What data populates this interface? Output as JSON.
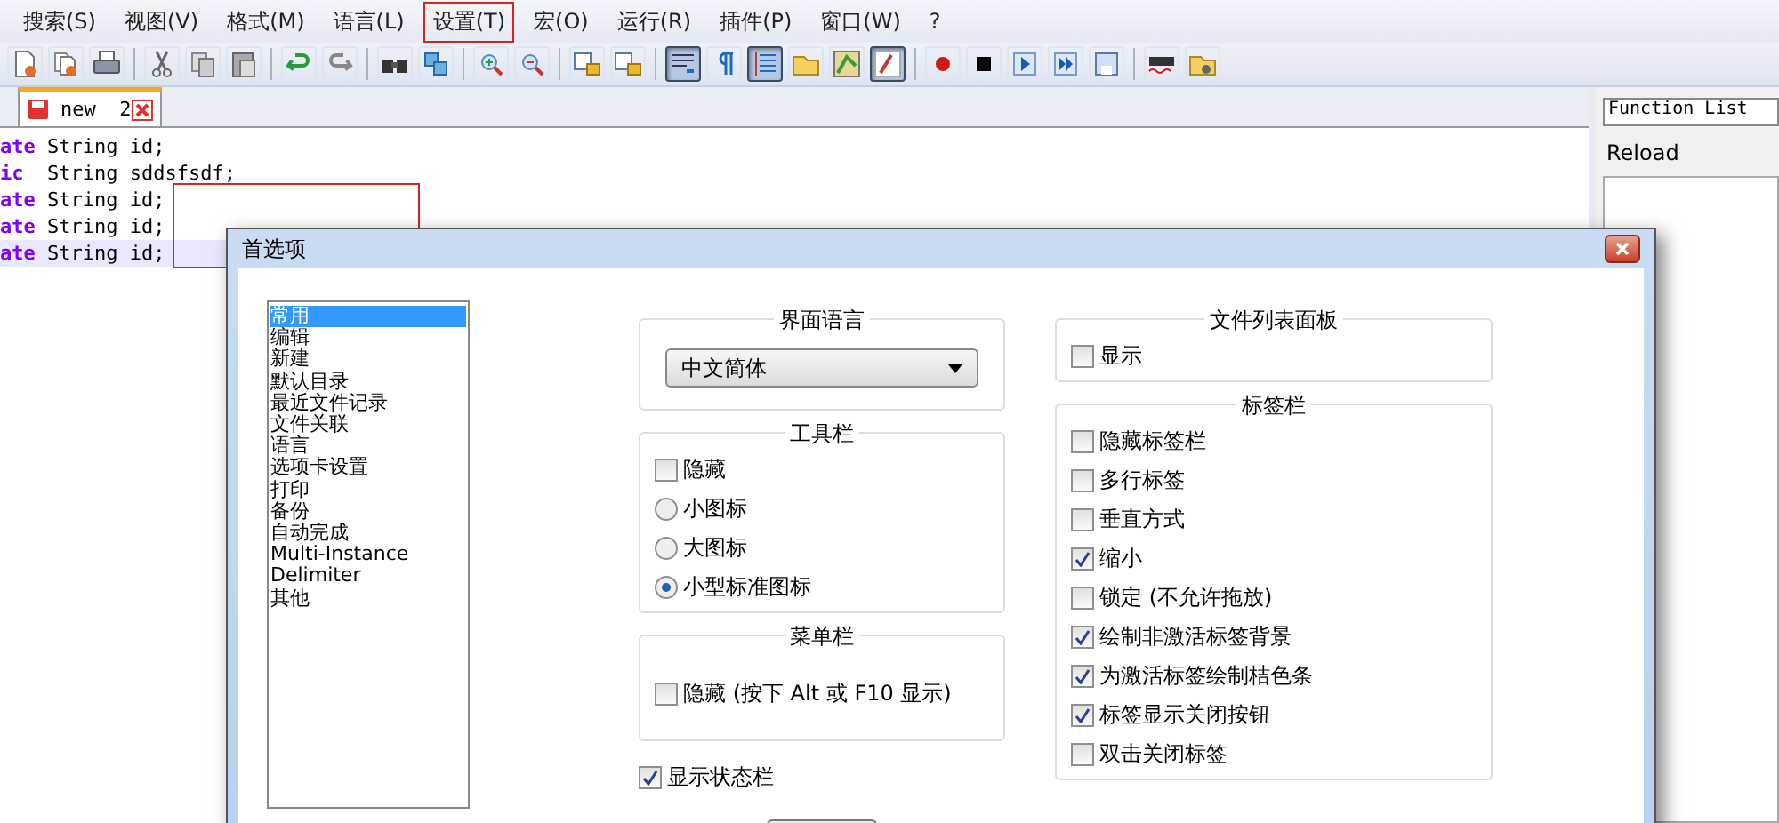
{
  "menu": [
    {
      "label": "搜索(S)",
      "highlighted": false
    },
    {
      "label": "视图(V)",
      "highlighted": false
    },
    {
      "label": "格式(M)",
      "highlighted": false
    },
    {
      "label": "语言(L)",
      "highlighted": false
    },
    {
      "label": "设置(T)",
      "highlighted": true
    },
    {
      "label": "宏(O)",
      "highlighted": false
    },
    {
      "label": "运行(R)",
      "highlighted": false
    },
    {
      "label": "插件(P)",
      "highlighted": false
    },
    {
      "label": "窗口(W)",
      "highlighted": false
    },
    {
      "label": "?",
      "highlighted": false
    }
  ],
  "toolbar": [
    {
      "kind": "new",
      "pressed": false
    },
    {
      "kind": "open",
      "pressed": false
    },
    {
      "kind": "print",
      "pressed": false
    },
    {
      "kind": "sep"
    },
    {
      "kind": "cut",
      "pressed": false
    },
    {
      "kind": "copy",
      "pressed": false
    },
    {
      "kind": "paste",
      "pressed": false
    },
    {
      "kind": "sep"
    },
    {
      "kind": "undo",
      "pressed": false
    },
    {
      "kind": "redo",
      "pressed": false
    },
    {
      "kind": "sep"
    },
    {
      "kind": "find",
      "pressed": false
    },
    {
      "kind": "replace",
      "pressed": false
    },
    {
      "kind": "sep"
    },
    {
      "kind": "zoomin",
      "pressed": false
    },
    {
      "kind": "zoomout",
      "pressed": false
    },
    {
      "kind": "sep"
    },
    {
      "kind": "syncv",
      "pressed": false
    },
    {
      "kind": "synch",
      "pressed": false
    },
    {
      "kind": "sep"
    },
    {
      "kind": "wrap",
      "pressed": true
    },
    {
      "kind": "pilcrow",
      "pressed": false
    },
    {
      "kind": "indent",
      "pressed": true
    },
    {
      "kind": "folder",
      "pressed": false
    },
    {
      "kind": "map",
      "pressed": false
    },
    {
      "kind": "func",
      "pressed": true
    },
    {
      "kind": "sep"
    },
    {
      "kind": "record",
      "pressed": false
    },
    {
      "kind": "stop",
      "pressed": false
    },
    {
      "kind": "play",
      "pressed": false
    },
    {
      "kind": "playmulti",
      "pressed": false
    },
    {
      "kind": "savemacro",
      "pressed": false
    },
    {
      "kind": "sep"
    },
    {
      "kind": "spell",
      "pressed": false
    },
    {
      "kind": "plugin",
      "pressed": false
    }
  ],
  "tabs": [
    {
      "label": "new  2",
      "selected": true
    }
  ],
  "editor": {
    "lines": [
      {
        "keyword": "ate",
        "text": "String id;",
        "current": false
      },
      {
        "keyword": "ic",
        "text": " String sddsfsdf;",
        "current": false
      },
      {
        "keyword": "ate",
        "text": "String id;",
        "current": false
      },
      {
        "keyword": "ate",
        "text": "String id;",
        "current": false
      },
      {
        "keyword": "ate",
        "text": "String id;",
        "current": true
      }
    ]
  },
  "annotations": [
    {
      "kind": "rectangle"
    }
  ],
  "function_list": {
    "title": "Function List",
    "reload": "Reload"
  },
  "dialog": {
    "title": "首选项",
    "categories": [
      {
        "label": "常用",
        "selected": true
      },
      {
        "label": "编辑",
        "selected": false
      },
      {
        "label": "新建",
        "selected": false
      },
      {
        "label": "默认目录",
        "selected": false
      },
      {
        "label": "最近文件记录",
        "selected": false
      },
      {
        "label": "文件关联",
        "selected": false
      },
      {
        "label": "语言",
        "selected": false
      },
      {
        "label": "选项卡设置",
        "selected": false
      },
      {
        "label": "打印",
        "selected": false
      },
      {
        "label": "备份",
        "selected": false
      },
      {
        "label": "自动完成",
        "selected": false
      },
      {
        "label": "Multi-Instance",
        "selected": false
      },
      {
        "label": "Delimiter",
        "selected": false
      },
      {
        "label": "其他",
        "selected": false
      }
    ],
    "language_group": {
      "title": "界面语言",
      "value": "中文简体"
    },
    "toolbar_group": {
      "title": "工具栏",
      "items": [
        {
          "kind": "checkbox",
          "label": "隐藏",
          "checked": false
        },
        {
          "kind": "radio",
          "label": "小图标",
          "checked": false
        },
        {
          "kind": "radio",
          "label": "大图标",
          "checked": false
        },
        {
          "kind": "radio",
          "label": "小型标准图标",
          "checked": true
        }
      ]
    },
    "menubar_group": {
      "title": "菜单栏",
      "items": [
        {
          "label": "隐藏 (按下 Alt 或 F10 显示)",
          "checked": false
        }
      ]
    },
    "status_bar": {
      "label": "显示状态栏",
      "checked": true
    },
    "filelist_group": {
      "title": "文件列表面板",
      "items": [
        {
          "label": "显示",
          "checked": false
        }
      ]
    },
    "tabbar_group": {
      "title": "标签栏",
      "items": [
        {
          "label": "隐藏标签栏",
          "checked": false
        },
        {
          "label": "多行标签",
          "checked": false
        },
        {
          "label": "垂直方式",
          "checked": false
        },
        {
          "label": "缩小",
          "checked": true
        },
        {
          "label": "锁定 (不允许拖放)",
          "checked": false
        },
        {
          "label": "绘制非激活标签背景",
          "checked": true
        },
        {
          "label": "为激活标签绘制桔色条",
          "checked": true
        },
        {
          "label": "标签显示关闭按钮",
          "checked": true
        },
        {
          "label": "双击关闭标签",
          "checked": false
        }
      ]
    }
  }
}
